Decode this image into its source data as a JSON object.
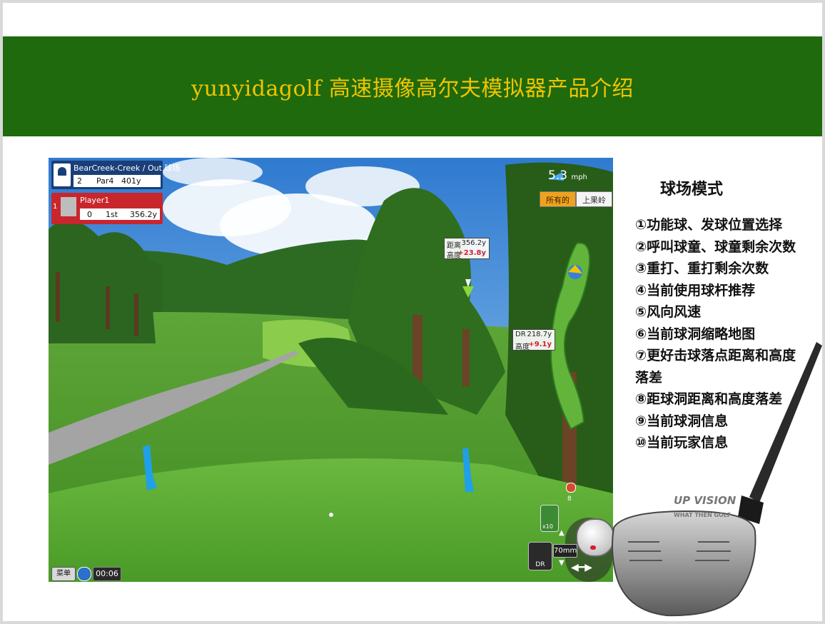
{
  "slide": {
    "title": "yunyidagolf 高速摄像高尔夫模拟器产品介绍"
  },
  "game": {
    "hole_info": {
      "course": "BearCreek-Creek / Out 球场",
      "hole_number": "2",
      "par": "Par4",
      "distance": "401y"
    },
    "player": {
      "index": "1",
      "name": "Player1",
      "score": "0",
      "shot": "1st",
      "remaining": "356.2y"
    },
    "pin_tag": {
      "distance_label": "距离",
      "distance_value": "356.2y",
      "height_label": "高度",
      "height_value": "+23.8y"
    },
    "landing_tag": {
      "club_label": "DR",
      "club_value": "218.7y",
      "height_label": "高度",
      "height_value": "+9.1y"
    },
    "wind": {
      "speed": "5.3",
      "unit": "mph"
    },
    "club_tabs": {
      "all": "所有的",
      "last": "上果岭"
    },
    "bottom_bar": {
      "menu": "菜单",
      "timer": "00:06"
    },
    "controls": {
      "club_dr": "DR",
      "club_10": "x10",
      "lens": "70mm",
      "pin_number": "8"
    }
  },
  "sidebar": {
    "title": "球场模式",
    "features": [
      "①功能球、发球位置选择",
      "②呼叫球童、球童剩余次数",
      "③重打、重打剩余次数",
      "④当前使用球杆推荐",
      "⑤风向风速",
      "⑥当前球洞缩略地图",
      "⑦更好击球落点距离和高度落差",
      "⑧距球洞距离和高度落差",
      "⑨当前球洞信息",
      "⑩当前玩家信息"
    ]
  },
  "brand": {
    "logo_text": "UP VISION",
    "logo_sub": "WHAT THEN GOLF"
  },
  "colors": {
    "banner": "#1e6a0d",
    "title": "#f2c300",
    "hud_blue": "#1a3f78",
    "hud_red": "#c8262c"
  }
}
